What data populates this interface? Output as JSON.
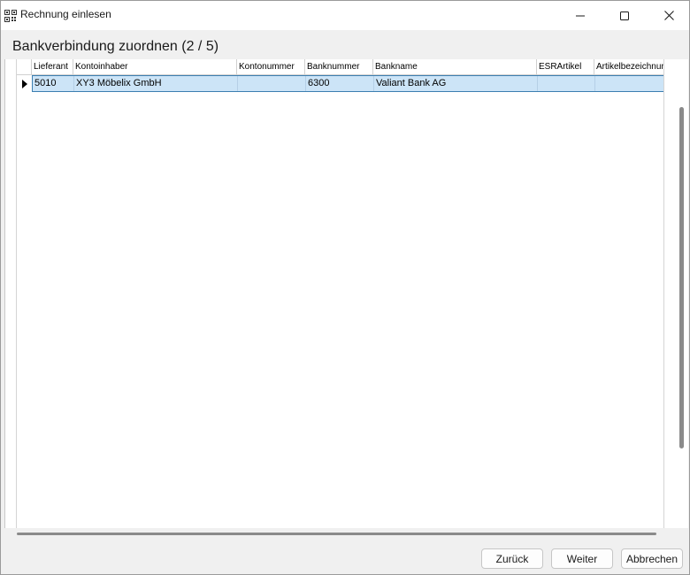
{
  "window": {
    "title": "Rechnung einlesen"
  },
  "page": {
    "heading": "Bankverbindung zuordnen (2 / 5)"
  },
  "grid": {
    "columns": [
      "Lieferant",
      "Kontoinhaber",
      "Kontonummer",
      "Banknummer",
      "Bankname",
      "ESRArtikel",
      "Artikelbezeichnung"
    ],
    "rows": [
      {
        "lieferant": "5010",
        "kontoinhaber": "XY3 Möbelix GmbH",
        "kontonummer": "",
        "banknummer": "6300",
        "bankname": "Valiant Bank AG",
        "esrartikel": "",
        "artikelbezeichnung": ""
      }
    ]
  },
  "buttons": {
    "back": "Zurück",
    "next": "Weiter",
    "cancel": "Abbrechen"
  },
  "colors": {
    "selection": "#cce4f7",
    "selection_border": "#3c7fb1"
  }
}
